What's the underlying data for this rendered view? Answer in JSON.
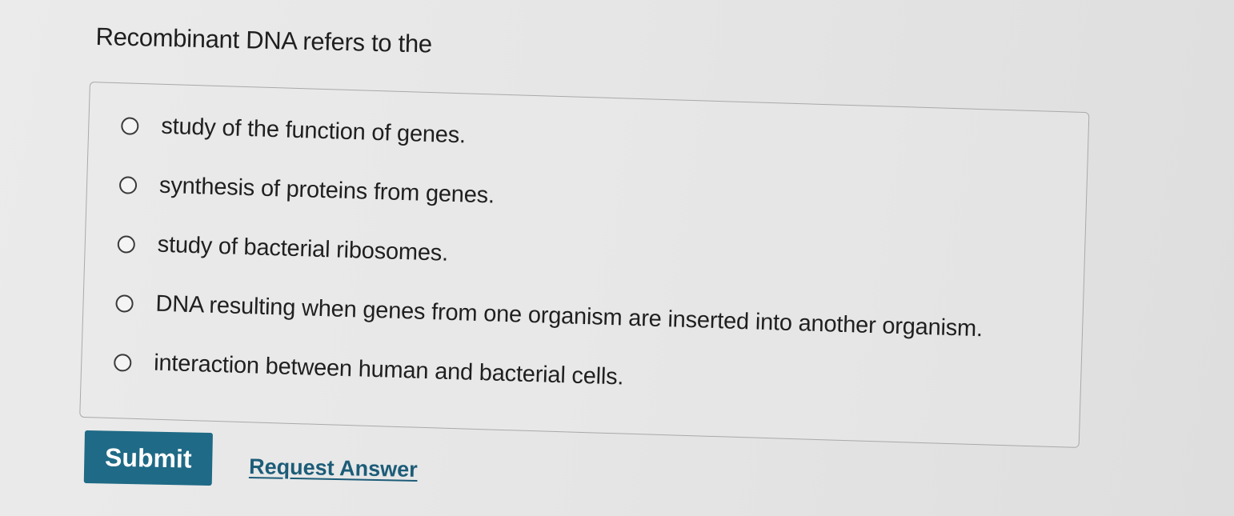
{
  "question": {
    "text": "Recombinant DNA refers to the"
  },
  "options": [
    {
      "label": "study of the function of genes.",
      "selected": false
    },
    {
      "label": "synthesis of proteins from genes.",
      "selected": false
    },
    {
      "label": "study of bacterial ribosomes.",
      "selected": false
    },
    {
      "label": "DNA resulting when genes from one organism are inserted into another organism.",
      "selected": false
    },
    {
      "label": "interaction between human and bacterial cells.",
      "selected": false
    }
  ],
  "actions": {
    "submit_label": "Submit",
    "request_answer_label": "Request Answer"
  },
  "colors": {
    "submit_background": "#1f6a86",
    "link": "#1c5c78"
  }
}
